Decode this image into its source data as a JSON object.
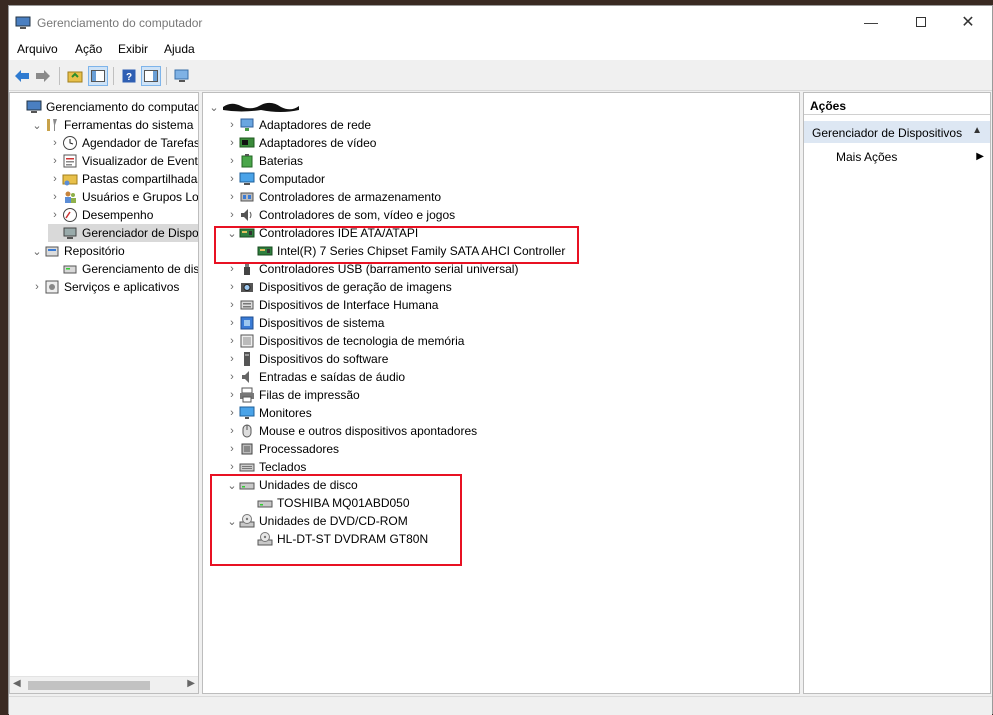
{
  "window": {
    "title": "Gerenciamento do computador"
  },
  "menu": [
    "Arquivo",
    "Ação",
    "Exibir",
    "Ajuda"
  ],
  "left_tree": [
    {
      "label": "Gerenciamento do computador",
      "icon": "computer-management-icon",
      "chev": "",
      "indent": 0
    },
    {
      "label": "Ferramentas do sistema",
      "icon": "tools-icon",
      "chev": "v",
      "indent": 1
    },
    {
      "label": "Agendador de Tarefas",
      "icon": "clock-icon",
      "chev": ">",
      "indent": 2
    },
    {
      "label": "Visualizador de Eventos",
      "icon": "event-viewer-icon",
      "chev": ">",
      "indent": 2
    },
    {
      "label": "Pastas compartilhadas",
      "icon": "shared-folder-icon",
      "chev": ">",
      "indent": 2
    },
    {
      "label": "Usuários e Grupos Loca",
      "icon": "users-icon",
      "chev": ">",
      "indent": 2
    },
    {
      "label": "Desempenho",
      "icon": "performance-icon",
      "chev": ">",
      "indent": 2
    },
    {
      "label": "Gerenciador de Disposit",
      "icon": "device-manager-icon",
      "chev": "",
      "indent": 2,
      "selected": true
    },
    {
      "label": "Repositório",
      "icon": "storage-icon",
      "chev": "v",
      "indent": 1
    },
    {
      "label": "Gerenciamento de disco",
      "icon": "disk-management-icon",
      "chev": "",
      "indent": 2
    },
    {
      "label": "Serviços e aplicativos",
      "icon": "services-icon",
      "chev": ">",
      "indent": 1
    }
  ],
  "device_tree": [
    {
      "label": "Adaptadores de rede",
      "icon": "network-adapter-icon",
      "chev": ">",
      "indent": 1
    },
    {
      "label": "Adaptadores de vídeo",
      "icon": "display-adapter-icon",
      "chev": ">",
      "indent": 1
    },
    {
      "label": "Baterias",
      "icon": "battery-icon",
      "chev": ">",
      "indent": 1
    },
    {
      "label": "Computador",
      "icon": "computer-icon",
      "chev": ">",
      "indent": 1
    },
    {
      "label": "Controladores de armazenamento",
      "icon": "storage-controller-icon",
      "chev": ">",
      "indent": 1
    },
    {
      "label": "Controladores de som, vídeo e jogos",
      "icon": "speaker-icon",
      "chev": ">",
      "indent": 1
    },
    {
      "label": "Controladores IDE ATA/ATAPI",
      "icon": "ide-controller-icon",
      "chev": "v",
      "indent": 1
    },
    {
      "label": "Intel(R) 7 Series Chipset Family SATA AHCI Controller",
      "icon": "ide-controller-icon",
      "chev": "",
      "indent": 2
    },
    {
      "label": "Controladores USB (barramento serial universal)",
      "icon": "usb-icon",
      "chev": ">",
      "indent": 1
    },
    {
      "label": "Dispositivos de geração de imagens",
      "icon": "camera-icon",
      "chev": ">",
      "indent": 1
    },
    {
      "label": "Dispositivos de Interface Humana",
      "icon": "hid-icon",
      "chev": ">",
      "indent": 1
    },
    {
      "label": "Dispositivos de sistema",
      "icon": "system-device-icon",
      "chev": ">",
      "indent": 1
    },
    {
      "label": "Dispositivos de tecnologia de memória",
      "icon": "memory-icon",
      "chev": ">",
      "indent": 1
    },
    {
      "label": "Dispositivos do software",
      "icon": "software-device-icon",
      "chev": ">",
      "indent": 1
    },
    {
      "label": "Entradas e saídas de áudio",
      "icon": "audio-icon",
      "chev": ">",
      "indent": 1
    },
    {
      "label": "Filas de impressão",
      "icon": "printer-icon",
      "chev": ">",
      "indent": 1
    },
    {
      "label": "Monitores",
      "icon": "monitor-icon",
      "chev": ">",
      "indent": 1
    },
    {
      "label": "Mouse e outros dispositivos apontadores",
      "icon": "mouse-icon",
      "chev": ">",
      "indent": 1
    },
    {
      "label": "Processadores",
      "icon": "processor-icon",
      "chev": ">",
      "indent": 1
    },
    {
      "label": "Teclados",
      "icon": "keyboard-icon",
      "chev": ">",
      "indent": 1
    },
    {
      "label": "Unidades de disco",
      "icon": "disk-drive-icon",
      "chev": "v",
      "indent": 1
    },
    {
      "label": "TOSHIBA MQ01ABD050",
      "icon": "disk-drive-icon",
      "chev": "",
      "indent": 2
    },
    {
      "label": "Unidades de DVD/CD-ROM",
      "icon": "dvd-icon",
      "chev": "v",
      "indent": 1
    },
    {
      "label": "HL-DT-ST DVDRAM GT80N",
      "icon": "dvd-icon",
      "chev": "",
      "indent": 2
    }
  ],
  "actions": {
    "header": "Ações",
    "section": "Gerenciador de Dispositivos",
    "more": "Mais Ações"
  },
  "colors": {
    "highlight": "#e81123",
    "accent": "#0078d7"
  }
}
